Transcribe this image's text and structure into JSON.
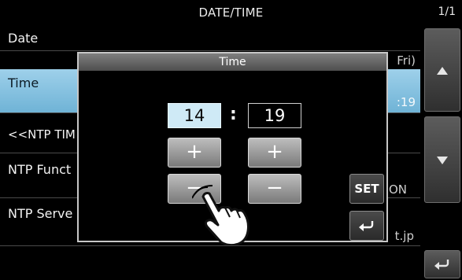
{
  "titlebar": {
    "title": "DATE/TIME",
    "page": "1/1"
  },
  "list": {
    "items": [
      {
        "label": "Date",
        "value": "Fri)"
      },
      {
        "label": "Time",
        "value": ":19"
      },
      {
        "label": "<<NTP TIM",
        "value": ""
      },
      {
        "label": "NTP Funct",
        "value": "ON"
      },
      {
        "label": "NTP Serve",
        "value": "t.jp"
      }
    ]
  },
  "scroll": {
    "up_icon": "triangle-up-icon",
    "down_icon": "triangle-down-icon",
    "back_icon": "return-arrow-icon"
  },
  "dialog": {
    "title": "Time",
    "hour": "14",
    "separator": ":",
    "minute": "19",
    "plus": "+",
    "minus": "−",
    "set_label": "SET",
    "back_icon": "return-arrow-icon"
  },
  "colors": {
    "selected_row": "#7fbfe0",
    "hour_field": "#cfeaf6",
    "background": "#000000"
  }
}
